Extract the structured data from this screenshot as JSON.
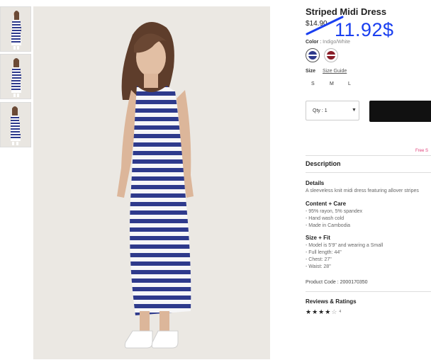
{
  "product": {
    "title": "Striped Midi Dress",
    "original_price": "$14.90",
    "new_price": "11.92$"
  },
  "color": {
    "label": "Color",
    "separator": ":",
    "selected": "Indigo/White",
    "swatches": [
      {
        "name": "Indigo/White",
        "color": "#2e3a8c"
      },
      {
        "name": "Burgundy",
        "color": "#8a1f2a"
      }
    ]
  },
  "size": {
    "label": "Size",
    "guide_label": "Size Guide",
    "options": [
      "S",
      "M",
      "L"
    ]
  },
  "quantity": {
    "label": "Qty : 1"
  },
  "promo": {
    "free_text": "Free S"
  },
  "description": {
    "heading": "Description",
    "details_heading": "Details",
    "details_text": "A sleeveless knit midi dress featuring allover stripes",
    "content_heading": "Content + Care",
    "content_lines": [
      "- 95% rayon, 5% spandex",
      "- Hand wash cold",
      "- Made in Cambodia"
    ],
    "fit_heading": "Size + Fit",
    "fit_lines": [
      "- Model is 5'9\" and wearing a Small",
      "- Full length: 44\"",
      "- Chest: 27\"",
      "- Waist: 28\""
    ],
    "product_code": "Product Code : 2000170350"
  },
  "reviews": {
    "heading": "Reviews & Ratings",
    "rating": 4,
    "max_rating": 5,
    "count": "4"
  },
  "colors": {
    "stripe_blue": "#2e3a8c",
    "annotation_blue": "#1a3ff0"
  }
}
